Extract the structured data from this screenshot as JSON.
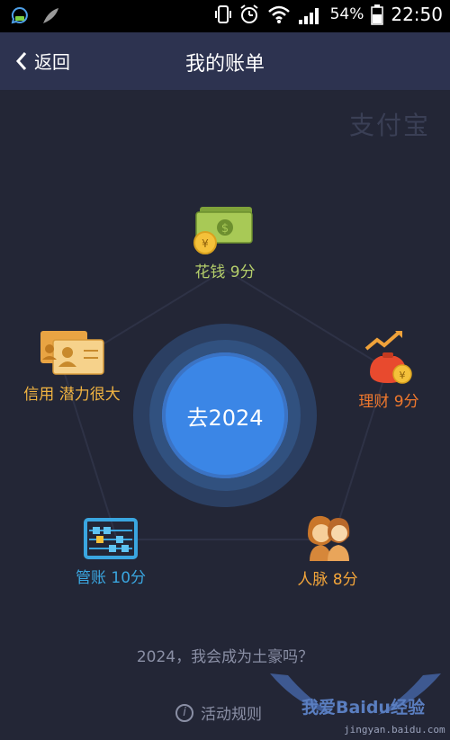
{
  "status_bar": {
    "battery_percent": "54%",
    "time": "22:50"
  },
  "navbar": {
    "back_label": "返回",
    "title": "我的账单"
  },
  "brand_logo": "支付宝",
  "center_button": "去2024",
  "categories": [
    {
      "label": "花钱 9分",
      "color": "#b5cf6b",
      "icon": "money-icon"
    },
    {
      "label": "理财 9分",
      "color": "#f0782d",
      "icon": "money-bag-icon"
    },
    {
      "label": "人脉 8分",
      "color": "#f3a53a",
      "icon": "people-icon"
    },
    {
      "label": "管账 10分",
      "color": "#3aa6e0",
      "icon": "abacus-icon"
    },
    {
      "label": "信用 潜力很大",
      "color": "#f2b441",
      "icon": "id-card-icon"
    }
  ],
  "question": "2024，我会成为土豪吗？",
  "rules_link": "活动规则",
  "watermark": {
    "text": "我爱Baidu经验",
    "url": "jingyan.baidu.com"
  }
}
